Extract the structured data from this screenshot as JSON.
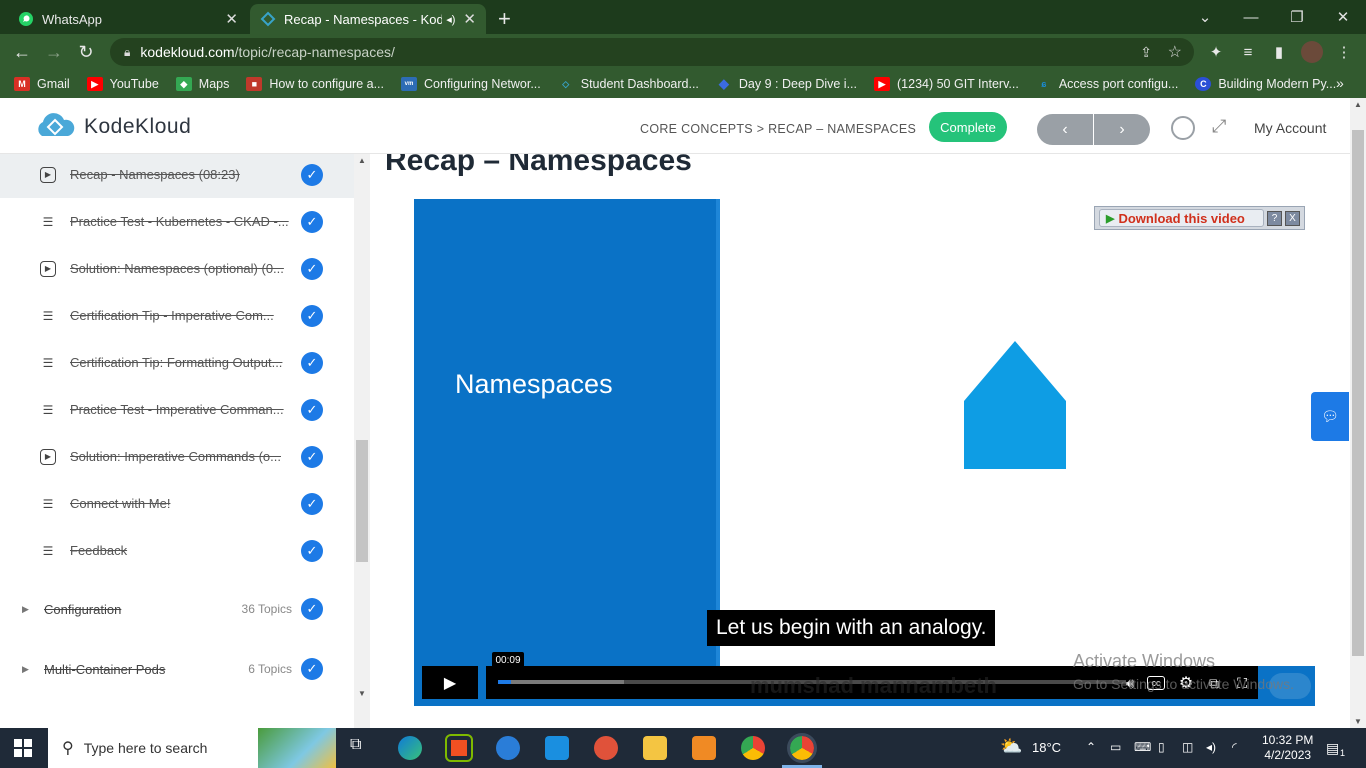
{
  "browser": {
    "tabs": [
      {
        "title": "WhatsApp",
        "active": false
      },
      {
        "title": "Recap - Namespaces - Kodel",
        "active": true
      }
    ],
    "url": {
      "host": "kodekloud.com",
      "path": "/topic/recap-namespaces/"
    },
    "bookmarks": [
      {
        "label": "Gmail",
        "icon": "gmail-icon",
        "color": "#d93025"
      },
      {
        "label": "YouTube",
        "icon": "youtube-icon",
        "color": "#ff0000"
      },
      {
        "label": "Maps",
        "icon": "maps-icon",
        "color": "#34a853"
      },
      {
        "label": "How to configure a...",
        "icon": "site-icon",
        "color": "#c0392b"
      },
      {
        "label": "Configuring Networ...",
        "icon": "vmware-icon",
        "color": "#2d6cb5"
      },
      {
        "label": "Student Dashboard...",
        "icon": "kodekloud-icon",
        "color": "#38a3c9"
      },
      {
        "label": "Day 9 : Deep Dive i...",
        "icon": "diamond-icon",
        "color": "#3b6be0"
      },
      {
        "label": "(1234) 50 GIT Interv...",
        "icon": "youtube-icon",
        "color": "#ff0000"
      },
      {
        "label": "Access port configu...",
        "icon": "site-icon",
        "color": "#1b8ad0"
      },
      {
        "label": "Building Modern Py...",
        "icon": "site-icon",
        "color": "#2b4fd6"
      }
    ]
  },
  "header": {
    "logo": "KodeKloud",
    "breadcrumb": "CORE CONCEPTS > RECAP – NAMESPACES",
    "complete_label": "Complete",
    "prev_label": "‹",
    "next_label": "›",
    "account_label": "My Account"
  },
  "sidebar": {
    "lessons": [
      {
        "label": "Recap - Namespaces (08:23)",
        "type": "video",
        "current": true,
        "done": true
      },
      {
        "label": "Practice Test - Kubernetes - CKAD -...",
        "type": "text",
        "done": true
      },
      {
        "label": "Solution: Namespaces (optional) (0...",
        "type": "video",
        "done": true
      },
      {
        "label": "Certification Tip - Imperative Com...",
        "type": "text",
        "done": true
      },
      {
        "label": "Certification Tip: Formatting Output...",
        "type": "text",
        "done": true
      },
      {
        "label": "Practice Test - Imperative Comman...",
        "type": "text",
        "done": true
      },
      {
        "label": "Solution: Imperative Commands (o...",
        "type": "video",
        "done": true
      },
      {
        "label": "Connect with Me!",
        "type": "text",
        "done": true
      },
      {
        "label": "Feedback",
        "type": "text",
        "done": true
      }
    ],
    "sections": [
      {
        "label": "Configuration",
        "count": "36 Topics",
        "done": true
      },
      {
        "label": "Multi-Container Pods",
        "count": "6 Topics",
        "done": true
      }
    ]
  },
  "main": {
    "title": "Recap – Namespaces",
    "video": {
      "slide_title": "Namespaces",
      "download_label": "Download this video",
      "help_label": "?",
      "close_label": "X",
      "caption": "Let us begin with an analogy.",
      "time_tooltip": "00:09",
      "watermark": "mumshad mannambeth",
      "progress_played": 0.02,
      "progress_buffered": 0.2
    }
  },
  "os_watermark": {
    "line1": "Activate Windows",
    "line2": "Go to Settings to activate Windows."
  },
  "taskbar": {
    "search_placeholder": "Type here to search",
    "weather": "18°C",
    "time": "10:32 PM",
    "date": "4/2/2023",
    "notification_count": "1"
  },
  "colors": {
    "accent": "#1d7ae6",
    "complete": "#25c37a",
    "slide_blue": "#0a72c6",
    "chrome_dark": "#1d3b1c",
    "chrome": "#325a2f"
  }
}
